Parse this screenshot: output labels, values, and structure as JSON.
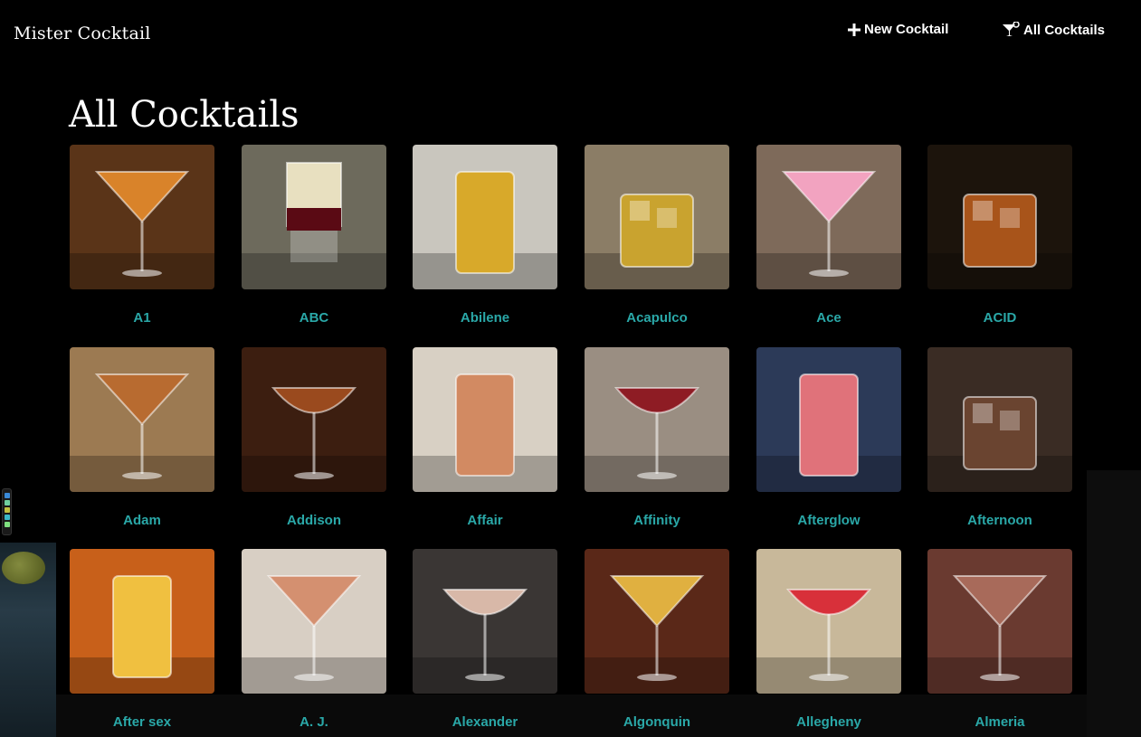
{
  "brand": "Mister Cocktail",
  "nav": {
    "new_label": "New Cocktail",
    "all_label": "All Cocktails"
  },
  "page_title": "All Cocktails",
  "cocktails": [
    {
      "name": "A1",
      "bg": "#5a3418",
      "drink": "#d9832a",
      "glass": "martini"
    },
    {
      "name": "ABC",
      "bg": "#6d6a5c",
      "drink": "#e8e0c0",
      "glass": "shot"
    },
    {
      "name": "Abilene",
      "bg": "#c9c6be",
      "drink": "#d8a92a",
      "glass": "highball"
    },
    {
      "name": "Acapulco",
      "bg": "#8b7d66",
      "drink": "#c9a32f",
      "glass": "rocks"
    },
    {
      "name": "Ace",
      "bg": "#7e6a5a",
      "drink": "#f2a3c0",
      "glass": "martini"
    },
    {
      "name": "ACID",
      "bg": "#1c140c",
      "drink": "#a8541a",
      "glass": "rocks"
    },
    {
      "name": "Adam",
      "bg": "#9c7a52",
      "drink": "#b86b30",
      "glass": "martini"
    },
    {
      "name": "Addison",
      "bg": "#3c1e10",
      "drink": "#9a4a1e",
      "glass": "coupe"
    },
    {
      "name": "Affair",
      "bg": "#d8d0c4",
      "drink": "#d28a62",
      "glass": "highball"
    },
    {
      "name": "Affinity",
      "bg": "#9a8e82",
      "drink": "#8e1c24",
      "glass": "coupe"
    },
    {
      "name": "Afterglow",
      "bg": "#2c3a58",
      "drink": "#e0727a",
      "glass": "highball"
    },
    {
      "name": "Afternoon",
      "bg": "#3a2c24",
      "drink": "#6a4430",
      "glass": "rocks"
    },
    {
      "name": "After sex",
      "bg": "#c8601a",
      "drink": "#f0c040",
      "glass": "highball"
    },
    {
      "name": "A. J.",
      "bg": "#d8cfc4",
      "drink": "#d49070",
      "glass": "martini"
    },
    {
      "name": "Alexander",
      "bg": "#3a3634",
      "drink": "#d8b8a8",
      "glass": "coupe"
    },
    {
      "name": "Algonquin",
      "bg": "#5a2818",
      "drink": "#e0b040",
      "glass": "martini"
    },
    {
      "name": "Allegheny",
      "bg": "#c8b89a",
      "drink": "#d8303a",
      "glass": "coupe"
    },
    {
      "name": "Almeria",
      "bg": "#6a3a30",
      "drink": "#a86a5a",
      "glass": "martini"
    }
  ]
}
